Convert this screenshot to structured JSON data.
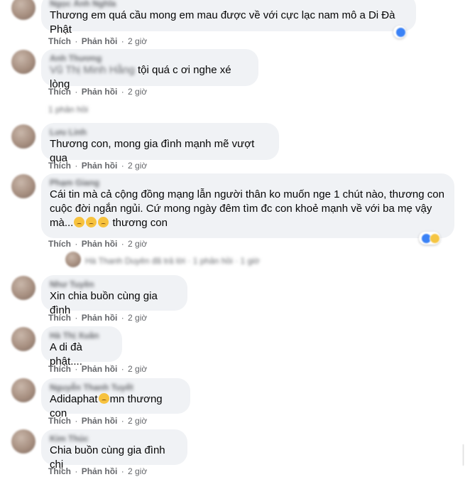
{
  "actions": {
    "like": "Thích",
    "reply": "Phản hồi",
    "sep": "·",
    "time": "2 giờ"
  },
  "comments": [
    {
      "author": "Ngọc Ánh Nghĩa",
      "text": "Thương em quá cầu mong em mau được về với cực lạc nam mô a Di Đà Phật"
    },
    {
      "author": "Anh Thương",
      "text_hidden": "Vũ Thị Minh Hằng",
      "text": "tội quá c ơi nghe xé lòng",
      "reply_info": "1 phản hồi"
    },
    {
      "author": "Lưu Linh",
      "text": "Thương con, mong gia đình mạnh mẽ vượt qua"
    },
    {
      "author": "Phạm Giang",
      "text": "Cái tin mà cả cộng đồng mạng lẫn người thân ko muốn nge 1 chút nào, thương con cuộc đời ngắn ngủi. Cứ mong ngày đêm tìm đc con khoẻ mạnh về với ba mẹ vậy mà...",
      "text_tail": "thương con",
      "reply_info": "Hà Thanh Duyên đã trả lời · 1 phản hồi · 1 giờ"
    },
    {
      "author": "Như Tuyền",
      "text": "Xin chia buồn cùng gia đình"
    },
    {
      "author": "Hà Thị Xuân",
      "text": "A di đà phật...."
    },
    {
      "author": "Nguyễn Thanh Tuyết",
      "text": "Adidaphat",
      "text_tail": "mn thương con"
    },
    {
      "author": "Kim Thúc",
      "text": "Chia buồn cùng gia đình chị"
    }
  ],
  "colors": {
    "bubble": "#f0f2f5",
    "meta": "#65676b",
    "text": "#050505"
  }
}
